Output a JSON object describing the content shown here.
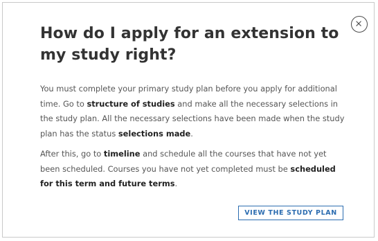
{
  "dialog": {
    "title": "How do I apply for an extension to my study right?",
    "paragraph1": {
      "t1": "You must complete your primary study plan before you apply for additional time. Go to ",
      "link1": "structure of studies",
      "t2": " and make all the necessary selections in the study plan. All the necessary selections have been made when the study plan has the status ",
      "status": "selections made",
      "t3": "."
    },
    "paragraph2": {
      "t1": "After this, go to ",
      "link1": "timeline",
      "t2": " and schedule all the courses that have not yet been scheduled. Courses you have not yet completed must be ",
      "emphasis": "scheduled for this term and future terms",
      "t3": "."
    },
    "cta_label": "VIEW THE STUDY PLAN",
    "close_icon": "close-icon"
  },
  "colors": {
    "accent": "#2b6cb0",
    "title": "#333333",
    "body": "#555555"
  }
}
